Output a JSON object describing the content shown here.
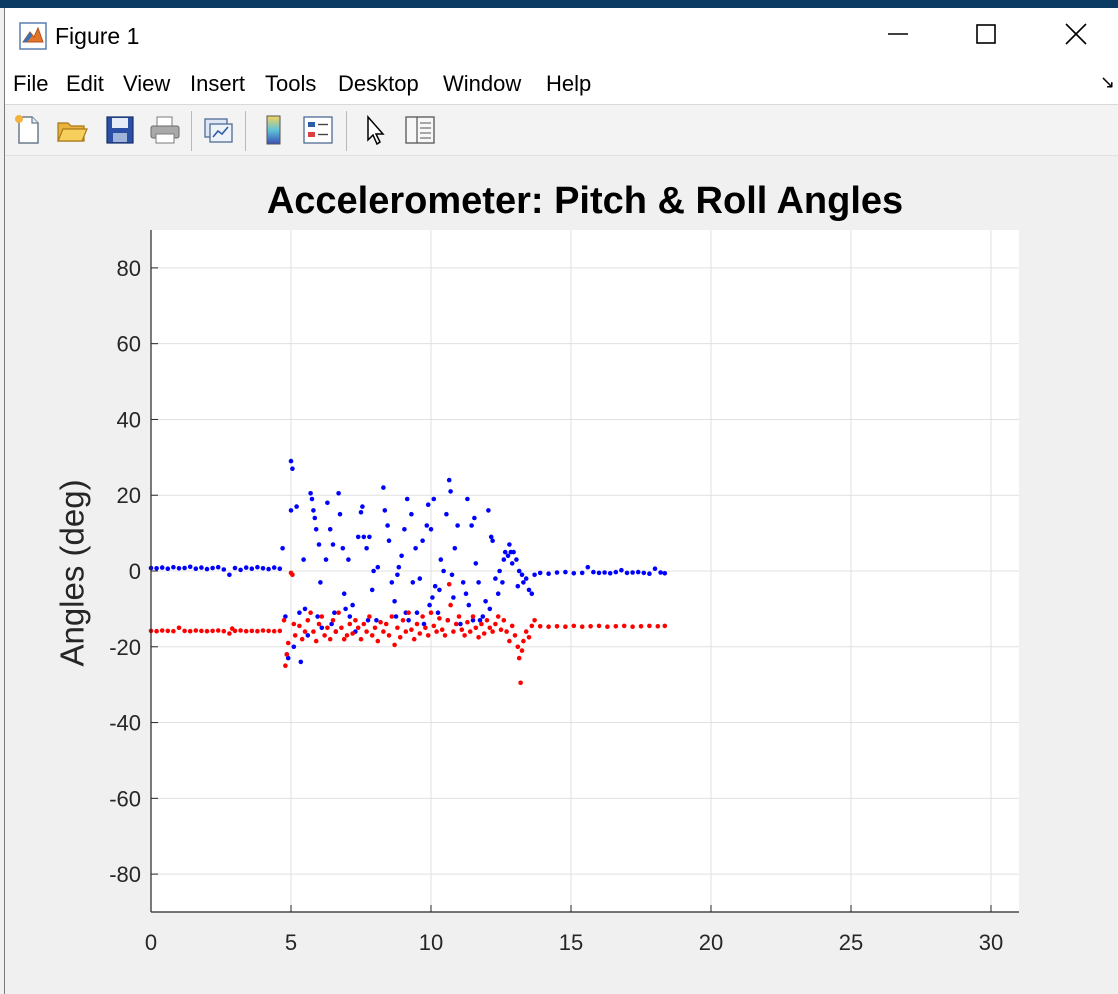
{
  "window": {
    "title": "Figure 1",
    "controls": [
      "minimize",
      "maximize",
      "close"
    ]
  },
  "menu": [
    "File",
    "Edit",
    "View",
    "Insert",
    "Tools",
    "Desktop",
    "Window",
    "Help"
  ],
  "toolbar": {
    "icons": [
      "new-figure-icon",
      "open-file-icon",
      "save-icon",
      "print-icon",
      "link-plot-icon",
      "insert-colorbar-icon",
      "insert-legend-icon",
      "edit-plot-arrow-icon",
      "property-inspector-icon"
    ]
  },
  "colors": {
    "pitch": "#0000ff",
    "roll": "#ff0000",
    "grid": "#e0e0e0",
    "axes": "#262626"
  },
  "chart_data": {
    "type": "scatter",
    "title": "Accelerometer: Pitch & Roll Angles",
    "xlabel": "",
    "ylabel": "Angles (deg)",
    "xlim": [
      0,
      31
    ],
    "ylim": [
      -90,
      90
    ],
    "xticks": [
      0,
      5,
      10,
      15,
      20,
      25,
      30
    ],
    "yticks": [
      -80,
      -60,
      -40,
      -20,
      0,
      20,
      40,
      60,
      80
    ],
    "grid": true,
    "series": [
      {
        "color": "#0000ff",
        "points": [
          [
            0.0,
            0.8
          ],
          [
            0.2,
            0.7
          ],
          [
            0.4,
            0.9
          ],
          [
            0.6,
            0.6
          ],
          [
            0.8,
            1.0
          ],
          [
            1.0,
            0.7
          ],
          [
            1.2,
            0.8
          ],
          [
            1.4,
            1.1
          ],
          [
            1.6,
            0.6
          ],
          [
            1.8,
            0.9
          ],
          [
            2.0,
            0.5
          ],
          [
            2.2,
            0.8
          ],
          [
            2.4,
            1.0
          ],
          [
            2.6,
            0.4
          ],
          [
            2.8,
            -1.0
          ],
          [
            3.0,
            0.8
          ],
          [
            3.2,
            0.3
          ],
          [
            3.4,
            0.9
          ],
          [
            3.6,
            0.6
          ],
          [
            3.8,
            1.0
          ],
          [
            4.0,
            0.7
          ],
          [
            4.2,
            0.5
          ],
          [
            4.4,
            0.9
          ],
          [
            4.6,
            0.6
          ],
          [
            4.7,
            6.0
          ],
          [
            4.8,
            -12.0
          ],
          [
            4.85,
            -22.0
          ],
          [
            4.9,
            -23.0
          ],
          [
            5.0,
            29.0
          ],
          [
            5.05,
            27.0
          ],
          [
            5.0,
            16.0
          ],
          [
            5.1,
            -20.0
          ],
          [
            5.2,
            17.0
          ],
          [
            5.3,
            -11.0
          ],
          [
            5.35,
            -24.0
          ],
          [
            5.45,
            3.0
          ],
          [
            5.5,
            -10.0
          ],
          [
            5.6,
            -17.0
          ],
          [
            5.7,
            20.5
          ],
          [
            5.75,
            19.0
          ],
          [
            5.8,
            16.0
          ],
          [
            5.85,
            14.0
          ],
          [
            5.9,
            11.0
          ],
          [
            5.95,
            -12.0
          ],
          [
            6.0,
            7.0
          ],
          [
            6.05,
            -3.0
          ],
          [
            6.1,
            -15.0
          ],
          [
            6.25,
            3.0
          ],
          [
            6.3,
            18.0
          ],
          [
            6.4,
            11.0
          ],
          [
            6.45,
            -14.0
          ],
          [
            6.5,
            7.0
          ],
          [
            6.55,
            -11.0
          ],
          [
            6.6,
            -16.0
          ],
          [
            6.7,
            20.5
          ],
          [
            6.75,
            15.0
          ],
          [
            6.85,
            6.0
          ],
          [
            6.9,
            -6.0
          ],
          [
            6.95,
            -10.0
          ],
          [
            7.05,
            3.0
          ],
          [
            7.1,
            -12.0
          ],
          [
            7.2,
            -9.0
          ],
          [
            7.3,
            -16.0
          ],
          [
            7.4,
            9.0
          ],
          [
            7.5,
            15.5
          ],
          [
            7.55,
            17.0
          ],
          [
            7.6,
            9.0
          ],
          [
            7.7,
            6.0
          ],
          [
            7.75,
            -13.0
          ],
          [
            7.8,
            9.0
          ],
          [
            7.9,
            -5.0
          ],
          [
            7.95,
            0.0
          ],
          [
            8.05,
            -13.0
          ],
          [
            8.1,
            1.0
          ],
          [
            8.3,
            22.0
          ],
          [
            8.35,
            16.0
          ],
          [
            8.45,
            12.0
          ],
          [
            8.5,
            8.0
          ],
          [
            8.6,
            -3.0
          ],
          [
            8.7,
            -8.0
          ],
          [
            8.75,
            -12.0
          ],
          [
            8.8,
            -1.0
          ],
          [
            8.85,
            1.0
          ],
          [
            8.95,
            4.0
          ],
          [
            9.05,
            11.0
          ],
          [
            9.1,
            -11.0
          ],
          [
            9.15,
            19.0
          ],
          [
            9.2,
            -13.0
          ],
          [
            9.3,
            15.0
          ],
          [
            9.35,
            -3.0
          ],
          [
            9.45,
            6.0
          ],
          [
            9.5,
            -11.0
          ],
          [
            9.6,
            -2.0
          ],
          [
            9.7,
            8.0
          ],
          [
            9.75,
            -14.0
          ],
          [
            9.85,
            12.0
          ],
          [
            9.9,
            17.5
          ],
          [
            9.95,
            -9.0
          ],
          [
            10.0,
            11.0
          ],
          [
            10.05,
            -7.0
          ],
          [
            10.1,
            19.0
          ],
          [
            10.15,
            -4.0
          ],
          [
            10.25,
            -11.0
          ],
          [
            10.3,
            -5.0
          ],
          [
            10.35,
            3.0
          ],
          [
            10.45,
            0.0
          ],
          [
            10.55,
            15.0
          ],
          [
            10.6,
            -13.0
          ],
          [
            10.65,
            24.0
          ],
          [
            10.7,
            21.0
          ],
          [
            10.75,
            -1.0
          ],
          [
            10.8,
            -7.0
          ],
          [
            10.85,
            6.0
          ],
          [
            10.95,
            12.0
          ],
          [
            11.05,
            -14.0
          ],
          [
            11.15,
            -3.0
          ],
          [
            11.25,
            -6.0
          ],
          [
            11.3,
            19.0
          ],
          [
            11.35,
            -9.0
          ],
          [
            11.45,
            12.0
          ],
          [
            11.5,
            -13.0
          ],
          [
            11.55,
            14.0
          ],
          [
            11.6,
            2.0
          ],
          [
            11.7,
            -3.0
          ],
          [
            11.75,
            -13.0
          ],
          [
            11.85,
            -12.0
          ],
          [
            11.95,
            -8.0
          ],
          [
            12.05,
            16.0
          ],
          [
            12.1,
            -10.0
          ],
          [
            12.15,
            9.0
          ],
          [
            12.2,
            8.0
          ],
          [
            12.3,
            -2.0
          ],
          [
            12.4,
            -6.0
          ],
          [
            12.45,
            0.0
          ],
          [
            12.55,
            -3.0
          ],
          [
            12.6,
            3.0
          ],
          [
            12.65,
            5.0
          ],
          [
            12.75,
            4.0
          ],
          [
            12.8,
            7.0
          ],
          [
            12.85,
            5.0
          ],
          [
            12.9,
            2.0
          ],
          [
            12.95,
            5.0
          ],
          [
            13.05,
            3.0
          ],
          [
            13.1,
            -4.0
          ],
          [
            13.15,
            0.0
          ],
          [
            13.25,
            -1.0
          ],
          [
            13.3,
            -3.0
          ],
          [
            13.4,
            -2.0
          ],
          [
            13.5,
            -5.0
          ],
          [
            13.6,
            -6.0
          ],
          [
            13.7,
            -1.0
          ],
          [
            13.9,
            -0.5
          ],
          [
            14.2,
            -0.7
          ],
          [
            14.5,
            -0.4
          ],
          [
            14.8,
            -0.3
          ],
          [
            15.1,
            -0.6
          ],
          [
            15.4,
            -0.5
          ],
          [
            15.6,
            1.0
          ],
          [
            15.8,
            -0.3
          ],
          [
            16.0,
            -0.5
          ],
          [
            16.2,
            -0.4
          ],
          [
            16.4,
            -0.6
          ],
          [
            16.6,
            -0.3
          ],
          [
            16.8,
            0.2
          ],
          [
            17.0,
            -0.5
          ],
          [
            17.2,
            -0.4
          ],
          [
            17.4,
            -0.3
          ],
          [
            17.6,
            -0.5
          ],
          [
            17.8,
            -0.7
          ],
          [
            18.0,
            0.6
          ],
          [
            18.2,
            -0.4
          ],
          [
            18.35,
            -0.6
          ]
        ]
      },
      {
        "color": "#ff0000",
        "points": [
          [
            0.0,
            -15.8
          ],
          [
            0.2,
            -15.9
          ],
          [
            0.4,
            -15.7
          ],
          [
            0.6,
            -15.8
          ],
          [
            0.8,
            -15.9
          ],
          [
            1.0,
            -15.0
          ],
          [
            1.2,
            -15.8
          ],
          [
            1.4,
            -15.9
          ],
          [
            1.6,
            -15.7
          ],
          [
            1.8,
            -15.8
          ],
          [
            2.0,
            -15.9
          ],
          [
            2.2,
            -15.8
          ],
          [
            2.4,
            -15.7
          ],
          [
            2.6,
            -15.9
          ],
          [
            2.8,
            -16.5
          ],
          [
            2.9,
            -15.2
          ],
          [
            3.0,
            -15.8
          ],
          [
            3.2,
            -15.7
          ],
          [
            3.4,
            -15.9
          ],
          [
            3.6,
            -15.8
          ],
          [
            3.8,
            -15.9
          ],
          [
            4.0,
            -15.7
          ],
          [
            4.2,
            -15.8
          ],
          [
            4.4,
            -15.9
          ],
          [
            4.6,
            -15.8
          ],
          [
            4.75,
            -13.0
          ],
          [
            4.8,
            -25.0
          ],
          [
            4.85,
            -22.0
          ],
          [
            4.9,
            -19.0
          ],
          [
            5.0,
            -0.5
          ],
          [
            5.05,
            -1.0
          ],
          [
            5.1,
            -14.0
          ],
          [
            5.15,
            -17.0
          ],
          [
            5.3,
            -14.5
          ],
          [
            5.4,
            -18.0
          ],
          [
            5.5,
            -16.0
          ],
          [
            5.6,
            -13.0
          ],
          [
            5.7,
            -11.0
          ],
          [
            5.8,
            -16.0
          ],
          [
            5.9,
            -18.5
          ],
          [
            6.0,
            -14.0
          ],
          [
            6.1,
            -12.0
          ],
          [
            6.2,
            -17.0
          ],
          [
            6.3,
            -15.0
          ],
          [
            6.4,
            -18.0
          ],
          [
            6.5,
            -13.0
          ],
          [
            6.6,
            -16.0
          ],
          [
            6.7,
            -11.0
          ],
          [
            6.8,
            -15.0
          ],
          [
            6.9,
            -18.0
          ],
          [
            7.0,
            -17.0
          ],
          [
            7.1,
            -14.0
          ],
          [
            7.2,
            -16.5
          ],
          [
            7.3,
            -13.0
          ],
          [
            7.4,
            -15.0
          ],
          [
            7.5,
            -18.0
          ],
          [
            7.6,
            -14.0
          ],
          [
            7.7,
            -16.0
          ],
          [
            7.8,
            -12.0
          ],
          [
            7.9,
            -17.0
          ],
          [
            8.0,
            -15.0
          ],
          [
            8.1,
            -18.5
          ],
          [
            8.2,
            -13.5
          ],
          [
            8.3,
            -16.0
          ],
          [
            8.4,
            -14.0
          ],
          [
            8.5,
            -17.0
          ],
          [
            8.6,
            -12.0
          ],
          [
            8.7,
            -19.5
          ],
          [
            8.8,
            -15.0
          ],
          [
            8.9,
            -17.5
          ],
          [
            9.0,
            -13.0
          ],
          [
            9.1,
            -16.0
          ],
          [
            9.2,
            -11.0
          ],
          [
            9.3,
            -15.5
          ],
          [
            9.4,
            -18.0
          ],
          [
            9.5,
            -14.0
          ],
          [
            9.6,
            -16.5
          ],
          [
            9.7,
            -12.0
          ],
          [
            9.8,
            -15.0
          ],
          [
            9.9,
            -17.0
          ],
          [
            10.0,
            -11.0
          ],
          [
            10.1,
            -14.5
          ],
          [
            10.2,
            -16.0
          ],
          [
            10.3,
            -12.5
          ],
          [
            10.4,
            -15.5
          ],
          [
            10.5,
            -17.0
          ],
          [
            10.6,
            -13.0
          ],
          [
            10.65,
            -3.5
          ],
          [
            10.7,
            -9.0
          ],
          [
            10.8,
            -16.0
          ],
          [
            10.9,
            -14.0
          ],
          [
            11.0,
            -12.0
          ],
          [
            11.1,
            -15.5
          ],
          [
            11.2,
            -17.0
          ],
          [
            11.3,
            -13.5
          ],
          [
            11.4,
            -16.0
          ],
          [
            11.5,
            -12.0
          ],
          [
            11.6,
            -15.0
          ],
          [
            11.7,
            -17.5
          ],
          [
            11.8,
            -14.0
          ],
          [
            11.9,
            -16.5
          ],
          [
            12.0,
            -13.0
          ],
          [
            12.1,
            -15.0
          ],
          [
            12.2,
            -16.0
          ],
          [
            12.3,
            -14.0
          ],
          [
            12.4,
            -12.0
          ],
          [
            12.5,
            -15.5
          ],
          [
            12.6,
            -13.0
          ],
          [
            12.7,
            -16.0
          ],
          [
            12.8,
            -18.5
          ],
          [
            12.9,
            -14.5
          ],
          [
            13.0,
            -17.0
          ],
          [
            13.1,
            -20.0
          ],
          [
            13.15,
            -23.0
          ],
          [
            13.2,
            -29.5
          ],
          [
            13.25,
            -21.0
          ],
          [
            13.3,
            -18.5
          ],
          [
            13.4,
            -16.0
          ],
          [
            13.5,
            -17.5
          ],
          [
            13.6,
            -14.5
          ],
          [
            13.7,
            -13.0
          ],
          [
            13.9,
            -14.6
          ],
          [
            14.2,
            -14.7
          ],
          [
            14.5,
            -14.6
          ],
          [
            14.8,
            -14.7
          ],
          [
            15.1,
            -14.5
          ],
          [
            15.4,
            -14.7
          ],
          [
            15.7,
            -14.6
          ],
          [
            16.0,
            -14.5
          ],
          [
            16.3,
            -14.7
          ],
          [
            16.6,
            -14.6
          ],
          [
            16.9,
            -14.5
          ],
          [
            17.2,
            -14.7
          ],
          [
            17.5,
            -14.6
          ],
          [
            17.8,
            -14.5
          ],
          [
            18.1,
            -14.6
          ],
          [
            18.35,
            -14.5
          ]
        ]
      }
    ]
  }
}
